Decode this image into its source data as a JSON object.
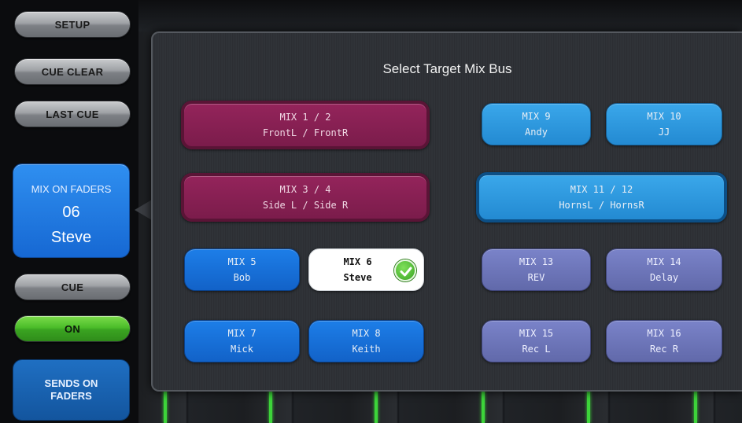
{
  "left_panel": {
    "setup": "SETUP",
    "cue_clear": "CUE CLEAR",
    "last_cue": "LAST CUE",
    "mix_on_faders": {
      "label": "MIX ON FADERS",
      "number": "06",
      "name": "Steve"
    },
    "cue": "CUE",
    "on": "ON",
    "sends_on_faders": {
      "line1": "SENDS ON",
      "line2": "FADERS"
    }
  },
  "modal": {
    "title": "Select Target Mix Bus",
    "selected": "MIX 6",
    "buttons": [
      {
        "id": "mix12",
        "title": "MIX 1 / 2",
        "name": "FrontL / FrontR",
        "style": "stereo-maroon"
      },
      {
        "id": "mix9",
        "title": "MIX 9",
        "name": "Andy",
        "style": "sky"
      },
      {
        "id": "mix10",
        "title": "MIX 10",
        "name": "JJ",
        "style": "sky"
      },
      {
        "id": "mix34",
        "title": "MIX 3 / 4",
        "name": "Side L / Side R",
        "style": "stereo-maroon"
      },
      {
        "id": "mix1112",
        "title": "MIX 11 / 12",
        "name": "HornsL / HornsR",
        "style": "stereo-sky"
      },
      {
        "id": "mix5",
        "title": "MIX 5",
        "name": "Bob",
        "style": "blue"
      },
      {
        "id": "mix6",
        "title": "MIX 6",
        "name": "Steve",
        "style": "selected"
      },
      {
        "id": "mix13",
        "title": "MIX 13",
        "name": "REV",
        "style": "purple"
      },
      {
        "id": "mix14",
        "title": "MIX 14",
        "name": "Delay",
        "style": "purple"
      },
      {
        "id": "mix7",
        "title": "MIX 7",
        "name": "Mick",
        "style": "blue"
      },
      {
        "id": "mix8",
        "title": "MIX 8",
        "name": "Keith",
        "style": "blue"
      },
      {
        "id": "mix15",
        "title": "MIX 15",
        "name": "Rec L",
        "style": "purple"
      },
      {
        "id": "mix16",
        "title": "MIX 16",
        "name": "Rec R",
        "style": "purple"
      }
    ]
  },
  "colors": {
    "maroon": "#7b1c4b",
    "sky": "#2b97dd",
    "blue": "#1a74dc",
    "purple": "#6c74b8",
    "on_green": "#4cbd2a",
    "check_green": "#3aa424"
  },
  "icons": {
    "selected_indicator": "check-circle-icon"
  }
}
